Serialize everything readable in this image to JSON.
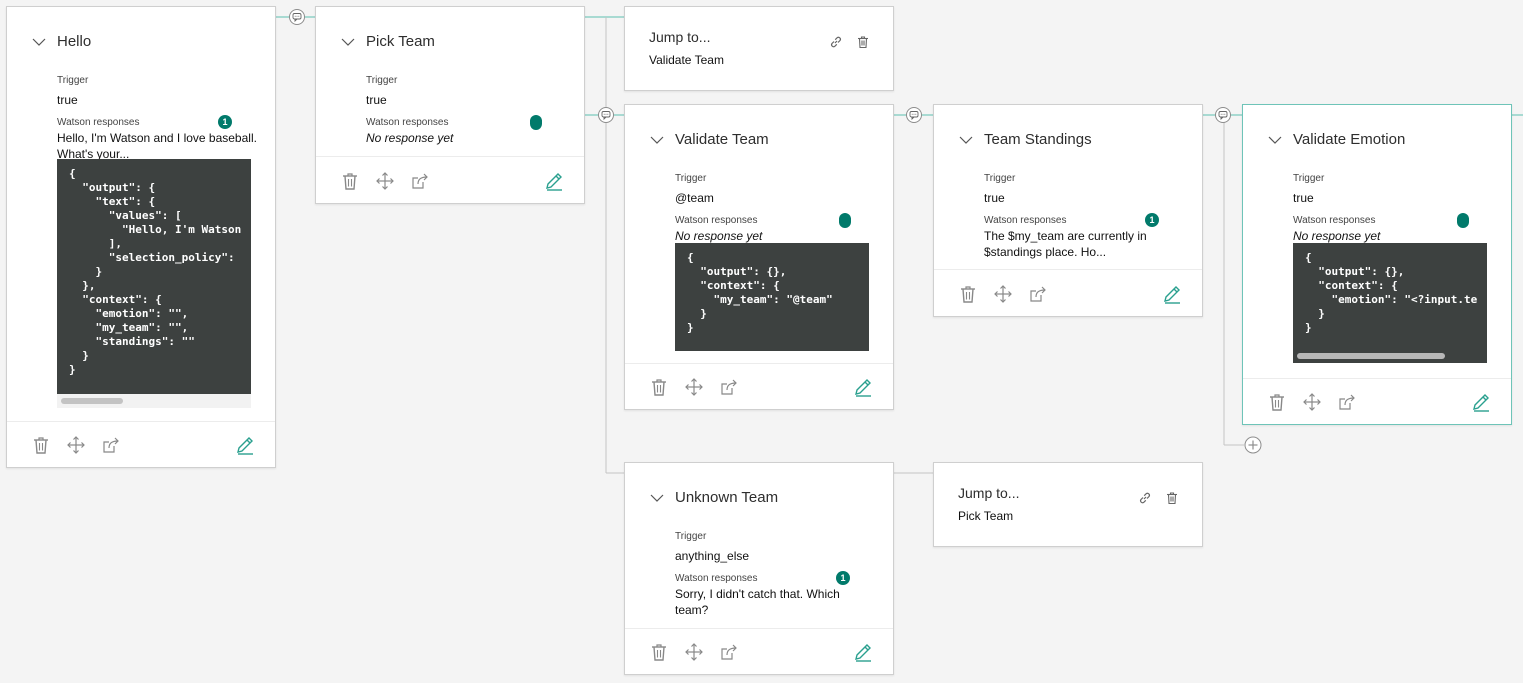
{
  "labels": {
    "trigger": "Trigger",
    "responses": "Watson responses"
  },
  "colors": {
    "accent": "#017a6b",
    "selected_border": "#6ec4b8",
    "connector": "#5dbfb0",
    "code_background": "#3d4140"
  },
  "icons": {
    "collapse": "chevron-down-icon",
    "delete": "trash-icon",
    "move": "move-arrows-icon",
    "jump_to": "jump-to-icon",
    "edit": "pencil-icon",
    "link": "link-icon",
    "condition": "comment-bubble-icon",
    "add": "add-node-icon"
  },
  "nodes": {
    "hello": {
      "title": "Hello",
      "trigger": "true",
      "response_count": "1",
      "response_line1": "Hello, I'm Watson and I love baseball.",
      "response_line2": "What's your...",
      "json": "{\n  \"output\": {\n    \"text\": {\n      \"values\": [\n        \"Hello, I'm Watson\n      ],\n      \"selection_policy\":\n    }\n  },\n  \"context\": {\n    \"emotion\": \"\",\n    \"my_team\": \"\",\n    \"standings\": \"\"\n  }\n}"
    },
    "pick_team": {
      "title": "Pick Team",
      "trigger": "true",
      "response": "No response yet"
    },
    "jump_validate": {
      "title": "Jump to...",
      "target": "Validate Team"
    },
    "validate_team": {
      "title": "Validate Team",
      "trigger": "@team",
      "response": "No response yet",
      "json": "{\n  \"output\": {},\n  \"context\": {\n    \"my_team\": \"@team\"\n  }\n}"
    },
    "team_standings": {
      "title": "Team Standings",
      "trigger": "true",
      "response_count": "1",
      "response_line1": "The $my_team are currently in",
      "response_line2": "$standings place. Ho..."
    },
    "validate_emotion": {
      "title": "Validate Emotion",
      "trigger": "true",
      "response": "No response yet",
      "json": "{\n  \"output\": {},\n  \"context\": {\n    \"emotion\": \"<?input.te\n  }\n}"
    },
    "unknown_team": {
      "title": "Unknown Team",
      "trigger": "anything_else",
      "response_count": "1",
      "response_line1": "Sorry, I didn't catch that. Which",
      "response_line2": "team?"
    },
    "jump_pick": {
      "title": "Jump to...",
      "target": "Pick Team"
    }
  }
}
